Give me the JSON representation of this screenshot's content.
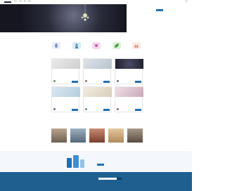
{
  "topbar": {
    "nav": [
      "Home",
      "Shop",
      "Blog",
      "About"
    ],
    "right": "Login"
  },
  "hero": {
    "line1": "",
    "line2": "",
    "right_title1": "",
    "right_title2": "",
    "right_sub": ""
  },
  "intro": {
    "heading": "",
    "text": ""
  },
  "categories": [
    {
      "label": "",
      "color": "#e9eefc"
    },
    {
      "label": "",
      "color": "#d9ecf7"
    },
    {
      "label": "",
      "color": "#f3d9ef"
    },
    {
      "label": "",
      "color": "#dff2dc"
    },
    {
      "label": "",
      "color": "#fce9e4"
    }
  ],
  "sections": {
    "products": "",
    "team": ""
  },
  "products": [
    {
      "name": "",
      "price": "",
      "img": "#dcdcdc",
      "avatar": "#6b8f5d"
    },
    {
      "name": "",
      "price": "",
      "img": "#cfd6dd",
      "avatar": "#8d6b5d"
    },
    {
      "name": "",
      "price": "",
      "img": "#2a2a3a",
      "avatar": "#5d6b8d"
    },
    {
      "name": "",
      "price": "",
      "img": "#cfe0ea",
      "avatar": "#6b5d8d"
    },
    {
      "name": "",
      "price": "",
      "img": "#ece6da",
      "avatar": "#5d8d86"
    },
    {
      "name": "",
      "price": "",
      "img": "#e7d6de",
      "avatar": "#8d5d7a"
    }
  ],
  "team": [
    {
      "name": "",
      "role": "",
      "photo": "#8b7d6b"
    },
    {
      "name": "",
      "role": "",
      "photo": "#6b7b8b"
    },
    {
      "name": "",
      "role": "",
      "photo": "#9b5d4b"
    },
    {
      "name": "",
      "role": "",
      "photo": "#c9a77a"
    },
    {
      "name": "",
      "role": "",
      "photo": "#7b6a5c"
    }
  ],
  "promo": {
    "title": "",
    "subtitle": ""
  },
  "footer": {
    "logo": "",
    "copyright": ""
  }
}
